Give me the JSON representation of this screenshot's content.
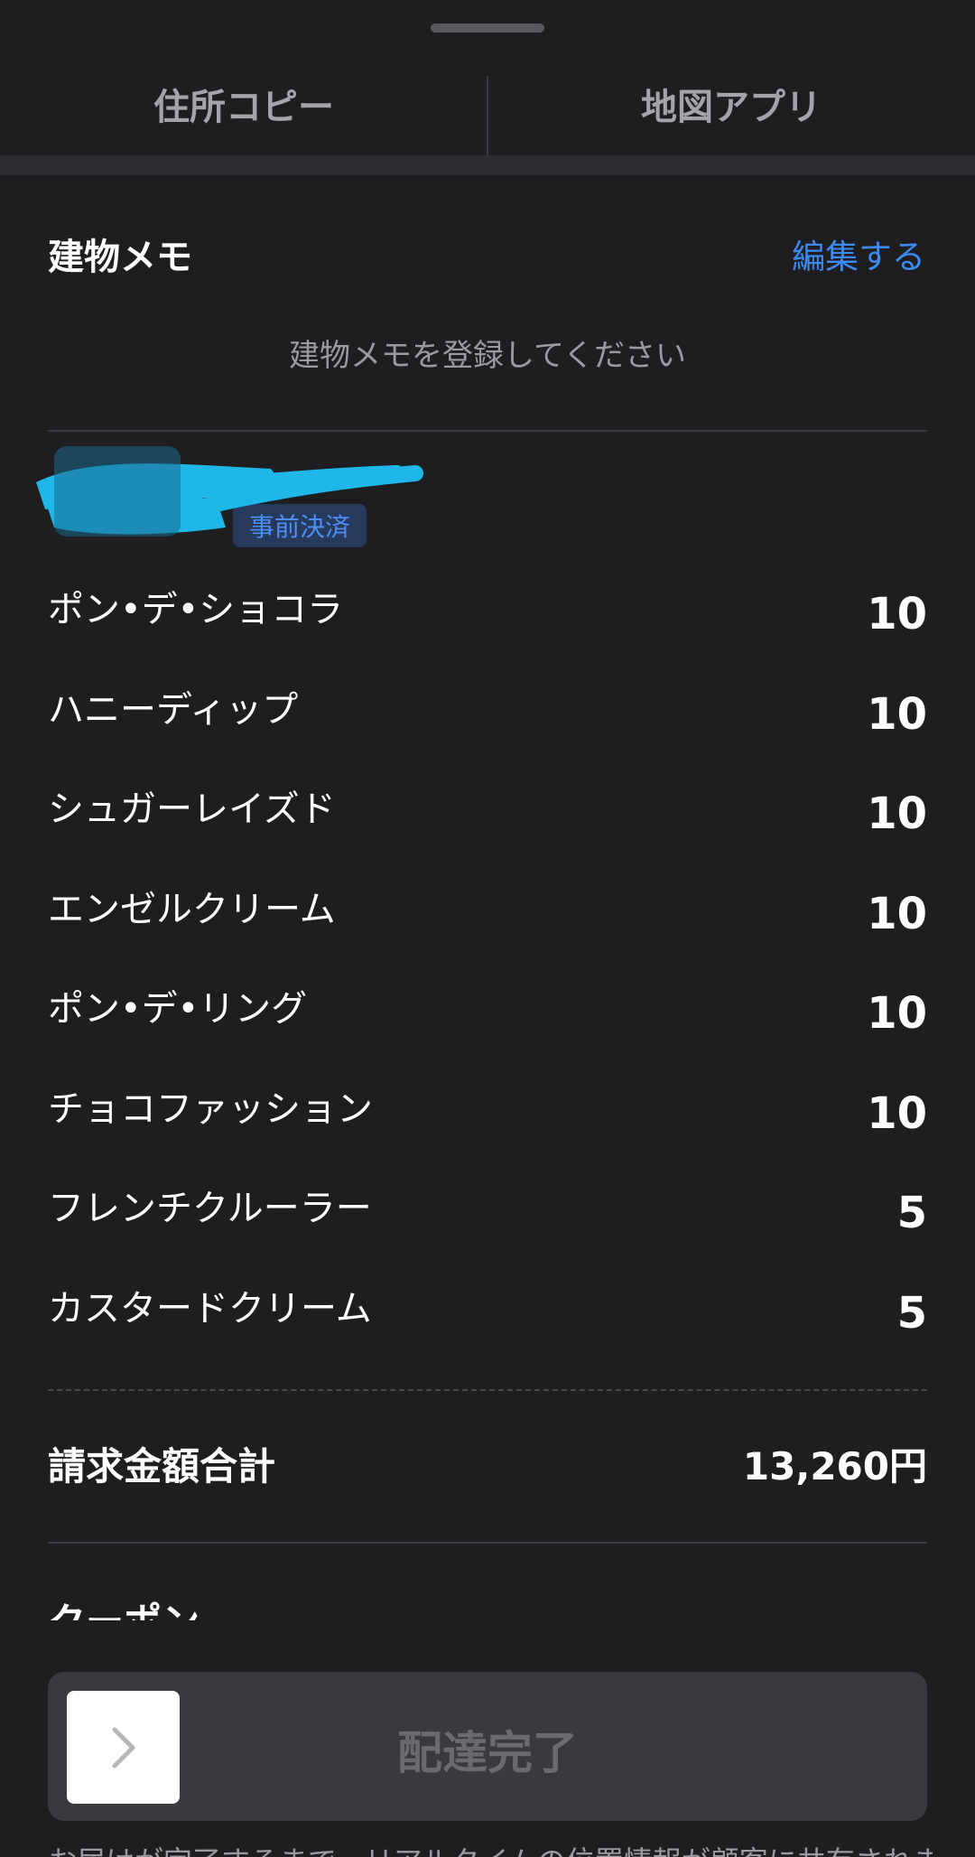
{
  "actions": {
    "copy_address": "住所コピー",
    "map_app": "地図アプリ"
  },
  "memo": {
    "title": "建物メモ",
    "edit_label": "編集する",
    "placeholder": "建物メモを登録してください"
  },
  "order": {
    "badge": "事前決済",
    "items": [
      {
        "name": "ポン•デ•ショコラ",
        "qty": "10"
      },
      {
        "name": "ハニーディップ",
        "qty": "10"
      },
      {
        "name": "シュガーレイズド",
        "qty": "10"
      },
      {
        "name": "エンゼルクリーム",
        "qty": "10"
      },
      {
        "name": "ポン•デ•リング",
        "qty": "10"
      },
      {
        "name": "チョコファッション",
        "qty": "10"
      },
      {
        "name": "フレンチクルーラー",
        "qty": "5"
      },
      {
        "name": "カスタードクリーム",
        "qty": "5"
      }
    ]
  },
  "billing": {
    "total_label": "請求金額合計",
    "total_value": "13,260円"
  },
  "coupon": {
    "title": "クーポン"
  },
  "delivery": {
    "complete_label": "配達完了"
  },
  "footer": {
    "note": "お届けが完了するまで、リアルタイムの位置情報が顧客に共有されます"
  },
  "colors": {
    "background": "#1e1e20",
    "accent": "#3d8bf2",
    "redaction": "#1fb6e8"
  }
}
